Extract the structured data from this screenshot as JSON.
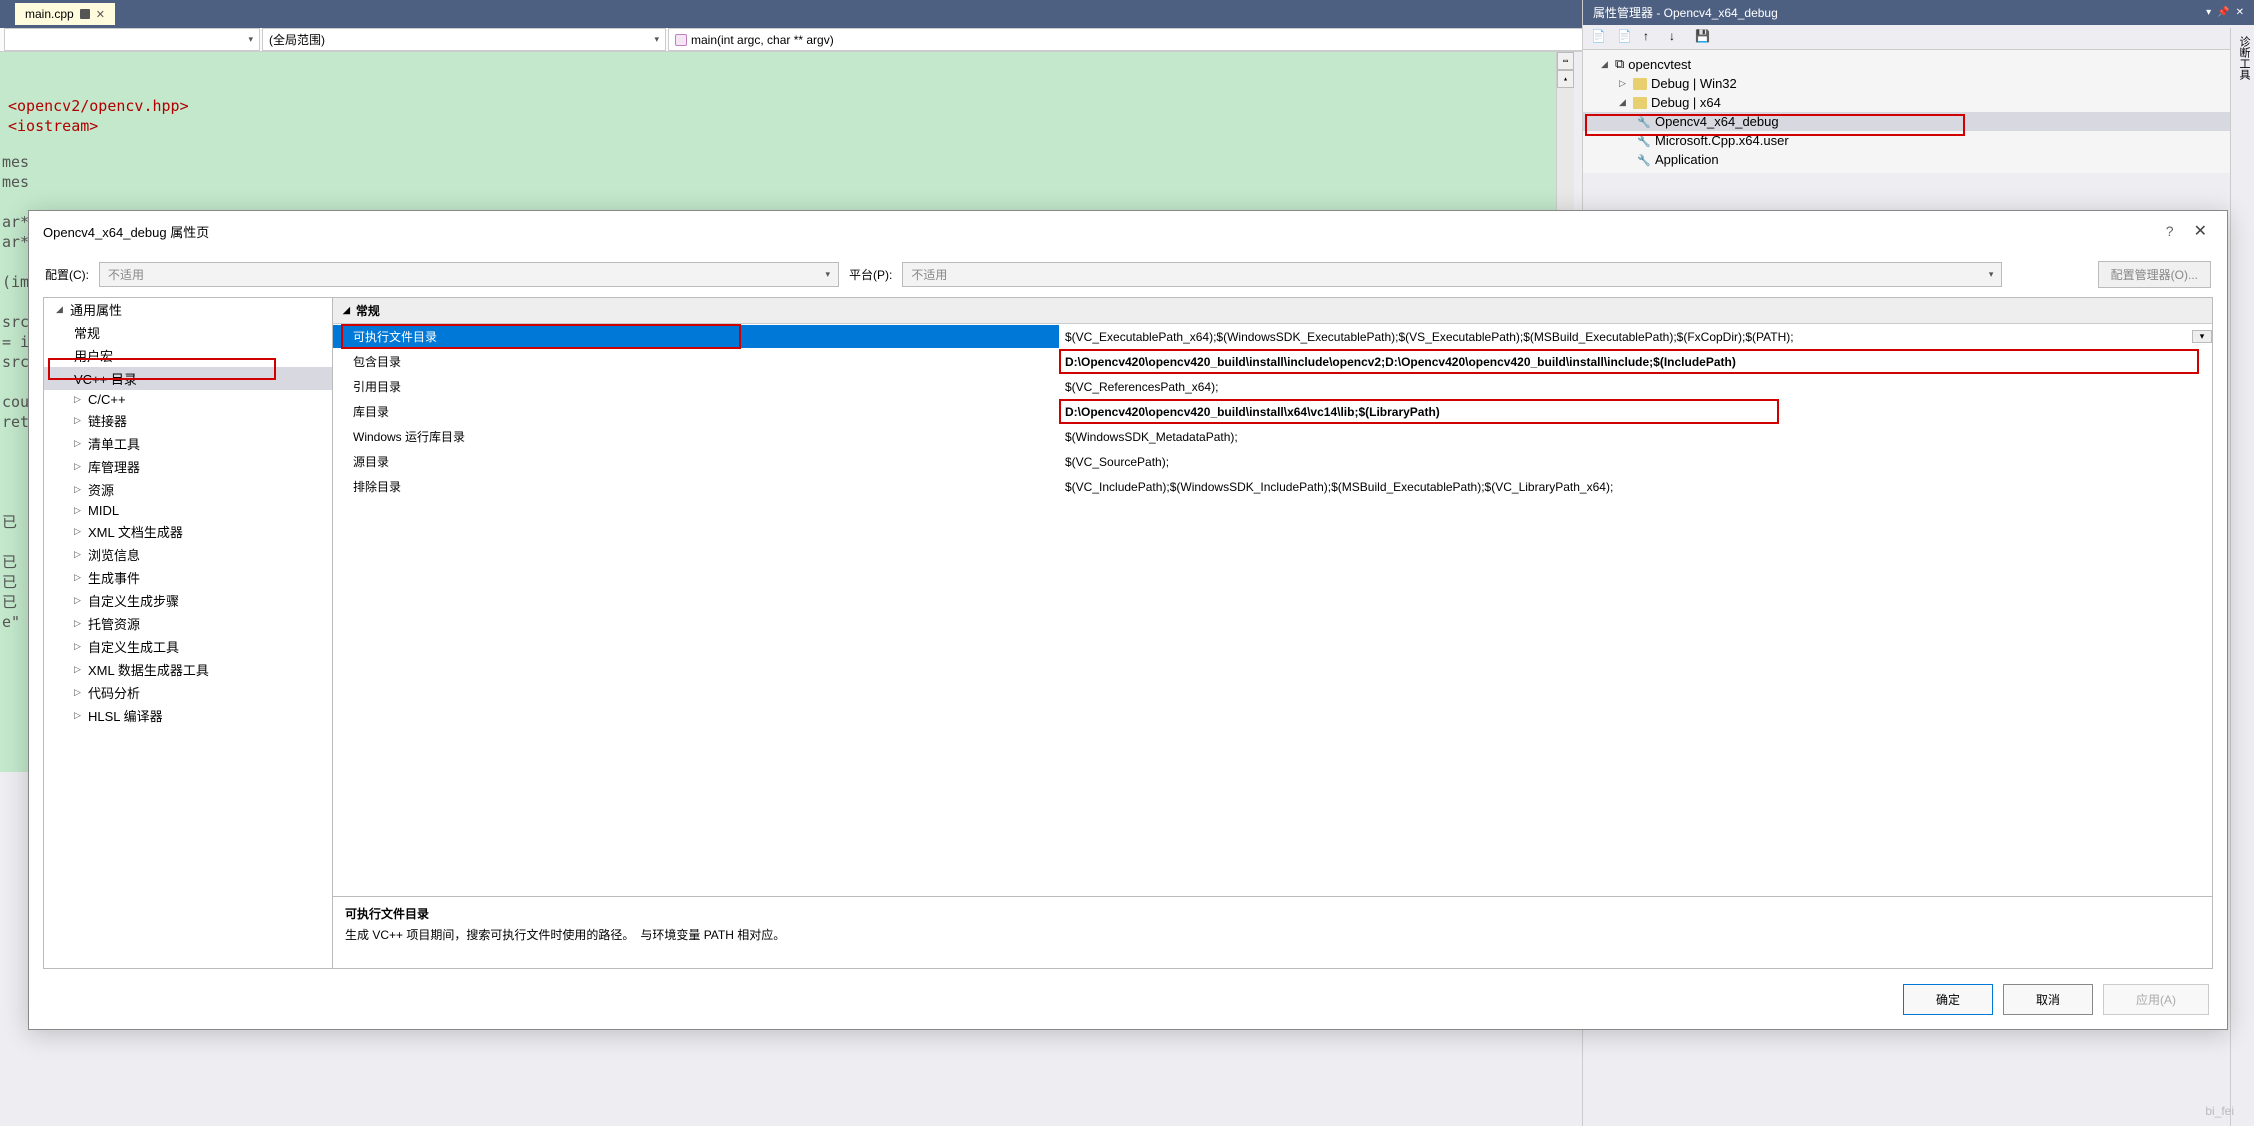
{
  "tab": {
    "name": "main.cpp"
  },
  "scope": {
    "dd2": "(全局范围)",
    "dd3": "main(int argc, char ** argv)"
  },
  "code": {
    "line1": "<opencv2/opencv.hpp>",
    "line2": "<iostream>",
    "partials": {
      "mes1": "mes",
      "mes2": "mes",
      "ar1": "ar*",
      "ar2": "ar*",
      "im": "(im",
      "src1": "src",
      "eq": "= i",
      "src2": "src",
      "cou": "cou",
      "ret": "ret",
      "yi": "已",
      "yi1": "已",
      "yi2": "已",
      "yi3": "已",
      "e": "e\""
    }
  },
  "propManager": {
    "title": "属性管理器 - Opencv4_x64_debug",
    "tree": {
      "root": "opencvtest",
      "n1": "Debug | Win32",
      "n2": "Debug | x64",
      "n2a": "Opencv4_x64_debug",
      "n2b": "Microsoft.Cpp.x64.user",
      "n2c": "Application"
    }
  },
  "sideStrip": "诊断工具",
  "dialog": {
    "title": "Opencv4_x64_debug 属性页",
    "configLabel": "配置(C):",
    "configVal": "不适用",
    "platformLabel": "平台(P):",
    "platformVal": "不适用",
    "mgrBtn": "配置管理器(O)...",
    "tree": {
      "t0": "通用属性",
      "t1": "常规",
      "t2": "用户宏",
      "t3": "VC++ 目录",
      "t4": "C/C++",
      "t5": "链接器",
      "t6": "清单工具",
      "t7": "库管理器",
      "t8": "资源",
      "t9": "MIDL",
      "t10": "XML 文档生成器",
      "t11": "浏览信息",
      "t12": "生成事件",
      "t13": "自定义生成步骤",
      "t14": "托管资源",
      "t15": "自定义生成工具",
      "t16": "XML 数据生成器工具",
      "t17": "代码分析",
      "t18": "HLSL 编译器"
    },
    "grid": {
      "header": "常规",
      "r0n": "可执行文件目录",
      "r0v": "$(VC_ExecutablePath_x64);$(WindowsSDK_ExecutablePath);$(VS_ExecutablePath);$(MSBuild_ExecutablePath);$(FxCopDir);$(PATH);",
      "r1n": "包含目录",
      "r1v": "D:\\Opencv420\\opencv420_build\\install\\include\\opencv2;D:\\Opencv420\\opencv420_build\\install\\include;$(IncludePath)",
      "r2n": "引用目录",
      "r2v": "$(VC_ReferencesPath_x64);",
      "r3n": "库目录",
      "r3v": "D:\\Opencv420\\opencv420_build\\install\\x64\\vc14\\lib;$(LibraryPath)",
      "r4n": "Windows 运行库目录",
      "r4v": "$(WindowsSDK_MetadataPath);",
      "r5n": "源目录",
      "r5v": "$(VC_SourcePath);",
      "r6n": "排除目录",
      "r6v": "$(VC_IncludePath);$(WindowsSDK_IncludePath);$(MSBuild_ExecutablePath);$(VC_LibraryPath_x64);"
    },
    "desc": {
      "title": "可执行文件目录",
      "text": "生成 VC++ 项目期间，搜索可执行文件时使用的路径。　与环境变量 PATH 相对应。"
    },
    "buttons": {
      "ok": "确定",
      "cancel": "取消",
      "apply": "应用(A)"
    }
  },
  "watermark": "bi_fei"
}
